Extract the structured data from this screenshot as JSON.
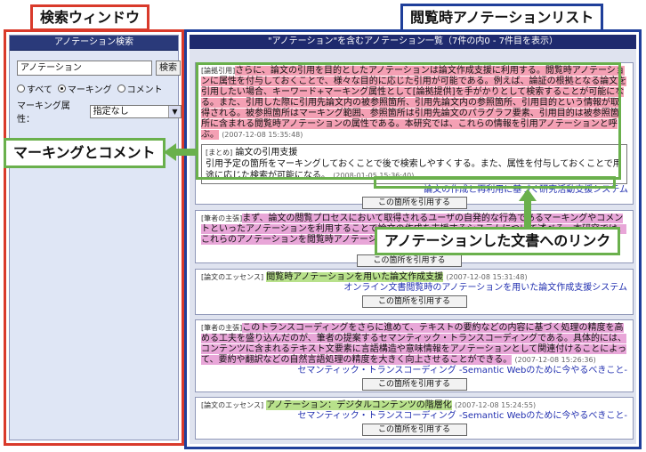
{
  "callouts": {
    "search_window": "検索ウィンドウ",
    "list": "閲覧時アノテーションリスト",
    "marking_comment": "マーキングとコメント",
    "document_link": "アノテーションした文書へのリンク"
  },
  "search": {
    "header": "アノテーション検索",
    "input_value": "アノテーション",
    "search_button": "検索",
    "radio_all": "すべて",
    "radio_marking": "マーキング",
    "radio_comment": "コメント",
    "selected_radio": "マーキング",
    "marking_attr_label": "マーキング属性：",
    "marking_attr_value": "指定なし"
  },
  "list": {
    "header": "\"アノテーション\"を含むアノテーション一覧（7件の内0 - 7件目を表示）",
    "cite_label": "この箇所を引用する",
    "entries": [
      {
        "tag": "[論拠引用]",
        "text": "さらに、論文の引用を目的としたアノテーションは論文作成支援に利用する。閲覧時アノテーションに属性を付与しておくことで、様々な目的に応じた引用が可能である。例えば、論証の根拠となる論文を引用したい場合、キーワード+マーキング属性として[論拠提供]を手がかりとして検索することが可能になる。また、引用した際に引用先論文内の被参照箇所、引用先論文内の参照箇所、引用目的という情報が取得される。被参照箇所はマーキング範囲、参照箇所は引用先論文のパラグラフ要素、引用目的は被参照箇所に含まれる閲覧時アノテーションの属性である。本研究では、これらの情報を引用アノテーションと呼ぶ。",
        "date": "(2007-12-08 15:35:48)",
        "comment_tag": "[まとめ]",
        "comment_title": "論文の引用支援",
        "comment_text": "引用予定の箇所をマーキングしておくことで後で検索しやすくする。また、属性を付与しておくことで用途に応じた検索が可能になる。",
        "comment_date": "(2008-01-05 15:36:40)",
        "link": "論文の作成と再利用に基づく研究活動支援システム"
      },
      {
        "tag": "[筆者の主張]",
        "text": "まず、論文の閲覧プロセスにおいて取得されるユーザの自発的な行為であるマーキングやコメントといったアノテーションを利用することで論文の作成を支援するシステムについて述べる。本研究では、これらのアノテーションを閲覧時アノテーションと呼ぶ。",
        "date": "",
        "link": ""
      },
      {
        "tag": "[論文のエッセンス]",
        "text": "閲覧時アノテーションを用いた論文作成支援",
        "date": "(2007-12-08 15:31:48)",
        "link": "オンライン文書閲覧時のアノテーションを用いた論文作成支援システム"
      },
      {
        "tag": "[筆者の主張]",
        "text": "このトランスコーディングをさらに進めて、テキストの要約などの内容に基づく処理の精度を高める工夫を盛り込んだのが、筆者の提案するセマンティック・トランスコーディングである。具体的には、コンテンツに含まれるテキスト文要素に言語構造や意味情報をアノテーションとして関連付けることによって、要約や翻訳などの自然言語処理の精度を大きく向上させることができる。",
        "date": "(2007-12-08 15:26:36)",
        "link": "セマンティック・トランスコーディング -Semantic Webのために今やるべきこと-"
      },
      {
        "tag": "[論文のエッセンス]",
        "text": "アノテーション：デジタルコンテンツの階層化",
        "date": "(2007-12-08 15:24:55)",
        "link": "セマンティック・トランスコーディング -Semantic Webのために今やるべきこと-"
      }
    ]
  }
}
